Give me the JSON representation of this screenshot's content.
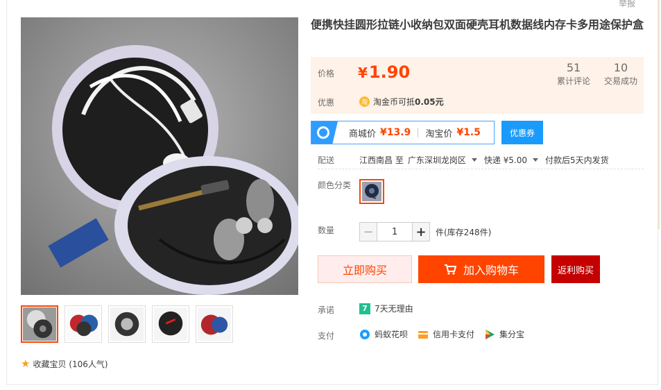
{
  "report": "举报",
  "product": {
    "title": "便携快挂圆形拉链小收纳包双面硬壳耳机数据线内存卡多用途保护盒"
  },
  "price": {
    "label": "价格",
    "currency": "¥",
    "value": "1.90",
    "reviews_count": "51",
    "reviews_label": "累计评论",
    "deals_count": "10",
    "deals_label": "交易成功"
  },
  "discount": {
    "label": "优惠",
    "badge": "淘",
    "text": "淘金币可抵",
    "amount": "0.05元"
  },
  "compare": {
    "mall_label": "商城价",
    "mall_price": "¥13.9",
    "taobao_label": "淘宝价",
    "taobao_price": "¥1.5",
    "coupon": "优惠券"
  },
  "shipping": {
    "label": "配送",
    "from": "江西南昌 至",
    "to": "广东深圳龙岗区",
    "method": "快递 ¥5.00",
    "note": "付款后5天内发货"
  },
  "color": {
    "label": "颜色分类"
  },
  "quantity": {
    "label": "数量",
    "minus": "−",
    "value": "1",
    "plus": "+",
    "stock": "件(库存248件)"
  },
  "buttons": {
    "buy_now": "立即购买",
    "add_cart": "加入购物车",
    "rebate": "返利购买"
  },
  "promise": {
    "label": "承诺",
    "badge": "7",
    "text": "7天无理由"
  },
  "payment": {
    "label": "支付",
    "methods": [
      "蚂蚁花呗",
      "信用卡支付",
      "集分宝"
    ]
  },
  "favorite": {
    "text": "收藏宝贝 (106人气)"
  },
  "colors": {
    "accent": "#ff4400",
    "price_bg": "#fff2e8",
    "coupon_blue": "#1a9bfc",
    "rebate_red": "#c40000"
  }
}
